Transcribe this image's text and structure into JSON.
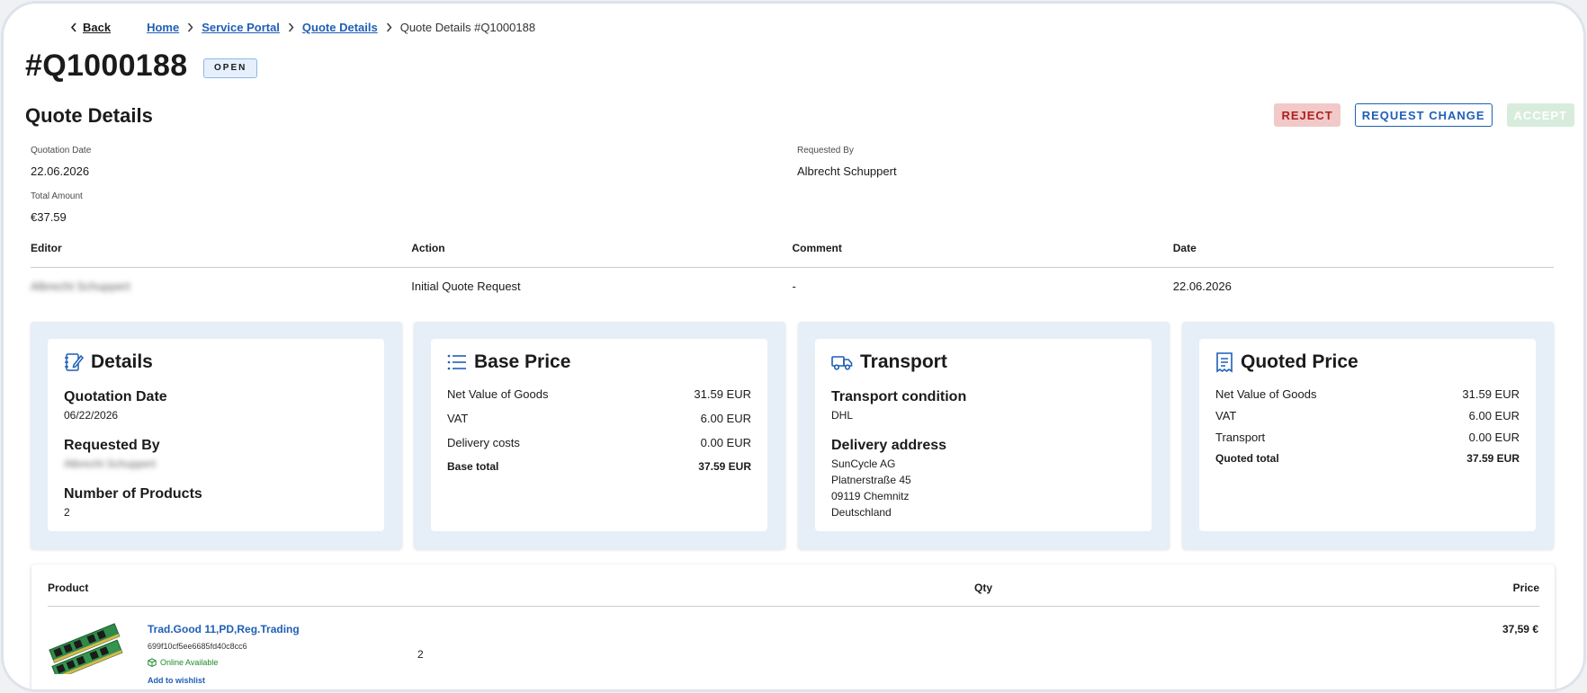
{
  "breadcrumb": {
    "back": "Back",
    "items": [
      "Home",
      "Service Portal",
      "Quote Details"
    ],
    "current": "Quote Details #Q1000188"
  },
  "quote": {
    "id": "#Q1000188",
    "status": "OPEN",
    "section_title": "Quote Details"
  },
  "actions": {
    "reject": "REJECT",
    "request_change": "REQUEST CHANGE",
    "accept": "ACCEPT"
  },
  "meta": {
    "quotation_date_label": "Quotation Date",
    "quotation_date": "22.06.2026",
    "requested_by_label": "Requested By",
    "requested_by": "Albrecht Schuppert",
    "total_amount_label": "Total Amount",
    "total_amount": "€37.59"
  },
  "history": {
    "columns": [
      "Editor",
      "Action",
      "Comment",
      "Date"
    ],
    "rows": [
      {
        "editor": "Albrecht Schuppert",
        "action": "Initial Quote Request",
        "comment": "-",
        "date": "22.06.2026"
      }
    ]
  },
  "cards": {
    "details": {
      "title": "Details",
      "quotation_date_label": "Quotation Date",
      "quotation_date": "06/22/2026",
      "requested_by_label": "Requested By",
      "requested_by": "Albrecht Schuppert",
      "products_label": "Number of Products",
      "products": "2"
    },
    "base_price": {
      "title": "Base Price",
      "rows": [
        {
          "label": "Net Value of Goods",
          "value": "31.59 EUR"
        },
        {
          "label": "VAT",
          "value": "6.00 EUR"
        },
        {
          "label": "Delivery costs",
          "value": "0.00 EUR"
        }
      ],
      "total_label": "Base total",
      "total_value": "37.59 EUR"
    },
    "transport": {
      "title": "Transport",
      "condition_label": "Transport condition",
      "condition": "DHL",
      "address_label": "Delivery address",
      "address_lines": [
        "SunCycle AG",
        "Platnerstraße 45",
        "09119 Chemnitz",
        "Deutschland"
      ]
    },
    "quoted_price": {
      "title": "Quoted Price",
      "rows": [
        {
          "label": "Net Value of Goods",
          "value": "31.59 EUR"
        },
        {
          "label": "VAT",
          "value": "6.00 EUR"
        },
        {
          "label": "Transport",
          "value": "0.00 EUR"
        }
      ],
      "total_label": "Quoted total",
      "total_value": "37.59 EUR"
    }
  },
  "products": {
    "columns": {
      "product": "Product",
      "qty": "Qty",
      "price": "Price"
    },
    "items": [
      {
        "name": "Trad.Good 11,PD,Reg.Trading",
        "sku": "699f10cf5ee6685fd40c8cc6",
        "availability": "Online Available",
        "wishlist": "Add to wishlist",
        "qty": "2",
        "price": "37,59 €"
      }
    ]
  },
  "colors": {
    "link": "#1f5fb5",
    "reject_bg": "#f1c9c9",
    "reject_text": "#b02020",
    "accept_bg": "#d8ecdc",
    "card_bg": "#e6eef8",
    "available": "#1f8a2a"
  },
  "icons": {
    "details": "edit-note-icon",
    "base_price": "list-icon",
    "transport": "truck-icon",
    "quoted_price": "receipt-icon"
  }
}
